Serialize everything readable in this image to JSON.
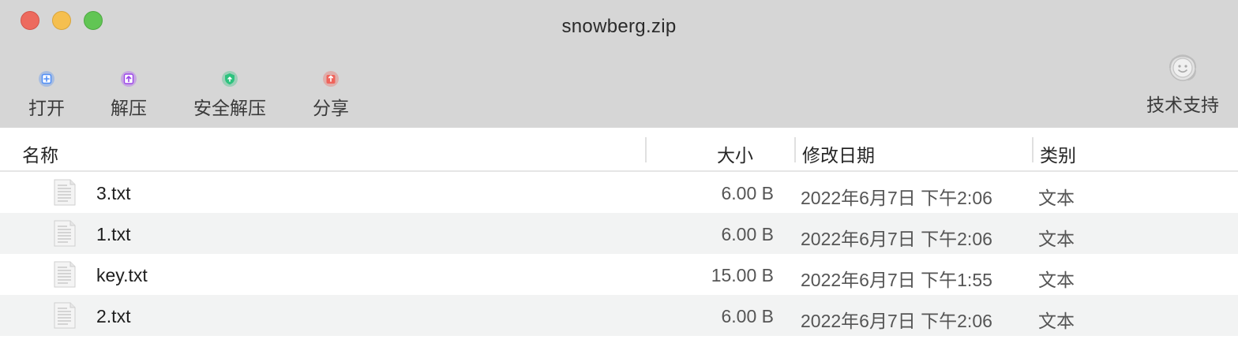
{
  "window": {
    "title": "snowberg.zip"
  },
  "toolbar": {
    "items": [
      {
        "label": "打开",
        "icon": "open-icon",
        "color": "#4f8ef7"
      },
      {
        "label": "解压",
        "icon": "extract-icon",
        "color": "#b160f5"
      },
      {
        "label": "安全解压",
        "icon": "secure-extract-icon",
        "color": "#2ec27e"
      },
      {
        "label": "分享",
        "icon": "share-icon",
        "color": "#f0645b"
      }
    ],
    "support": {
      "label": "技术支持",
      "icon": "headset-support-icon"
    }
  },
  "columns": {
    "name": "名称",
    "size": "大小",
    "date": "修改日期",
    "kind": "类别"
  },
  "files": [
    {
      "name": "3.txt",
      "size": "6.00 B",
      "date": "2022年6月7日 下午2:06",
      "kind": "文本",
      "icon": "text-file-icon"
    },
    {
      "name": "1.txt",
      "size": "6.00 B",
      "date": "2022年6月7日 下午2:06",
      "kind": "文本",
      "icon": "text-file-icon"
    },
    {
      "name": "key.txt",
      "size": "15.00 B",
      "date": "2022年6月7日 下午1:55",
      "kind": "文本",
      "icon": "text-file-icon"
    },
    {
      "name": "2.txt",
      "size": "6.00 B",
      "date": "2022年6月7日 下午2:06",
      "kind": "文本",
      "icon": "text-file-icon"
    }
  ]
}
